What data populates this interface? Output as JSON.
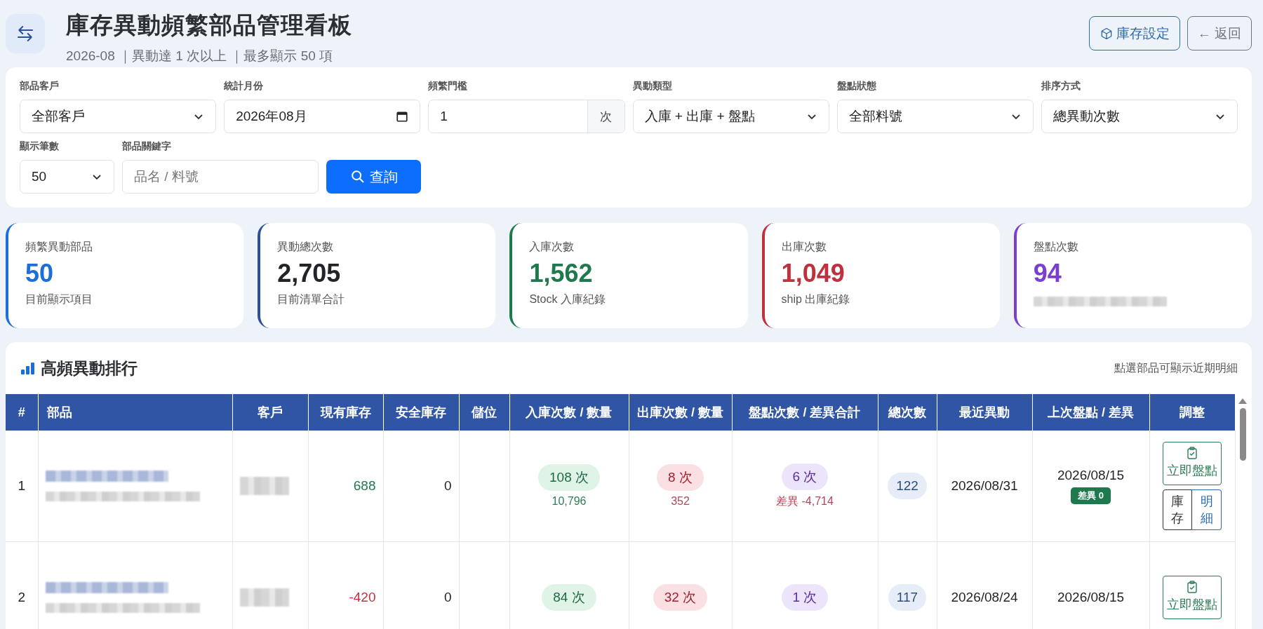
{
  "header": {
    "title": "庫存異動頻繁部品管理看板",
    "subtitle": "2026-08 ｜異動達 1 次以上 ｜最多顯示 50 項",
    "buttons": [
      {
        "kind": "settings",
        "label": "庫存設定"
      },
      {
        "kind": "back",
        "label": "← 返回"
      }
    ]
  },
  "filters": [
    {
      "kind": "select",
      "label": "部品客戶",
      "value": "全部客戶"
    },
    {
      "kind": "date",
      "label": "統計月份",
      "value": "2026年08月"
    },
    {
      "kind": "number",
      "label": "頻繁門檻",
      "value": "1",
      "unit": "次"
    },
    {
      "kind": "select",
      "label": "異動類型",
      "value": "入庫 + 出庫 + 盤點"
    },
    {
      "kind": "select",
      "label": "盤點狀態",
      "value": "全部料號"
    },
    {
      "kind": "select",
      "label": "排序方式",
      "value": "總異動次數"
    },
    {
      "kind": "select-small",
      "label": "顯示筆數",
      "value": "50"
    },
    {
      "kind": "text",
      "label": "部品關鍵字",
      "placeholder": "品名 / 料號"
    }
  ],
  "search_button": "查詢",
  "stats": [
    {
      "label": "頻繁異動部品",
      "value": "50",
      "note": "目前顯示項目",
      "color": "#1c6fd8"
    },
    {
      "label": "異動總次數",
      "value": "2,705",
      "note": "目前清單合計",
      "color": "#2c4f9a"
    },
    {
      "label": "入庫次數",
      "value": "1,562",
      "note": "Stock 入庫紀錄",
      "color": "#1e7a4c"
    },
    {
      "label": "出庫次數",
      "value": "1,049",
      "note": "ship 出庫紀錄",
      "color": "#c0313f"
    },
    {
      "label": "盤點次數",
      "value": "94",
      "color": "#7a3fcf"
    }
  ],
  "ranking": {
    "title": "高頻異動排行",
    "hint": "點選部品可顯示近期明細",
    "columns": [
      "#",
      "部品",
      "客戶",
      "現有庫存",
      "安全庫存",
      "儲位",
      "入庫次數 / 數量",
      "出庫次數 / 數量",
      "盤點次數 / 差異合計",
      "總次數",
      "最近異動",
      "上次盤點 / 差異",
      "調整"
    ],
    "rows": [
      {
        "rank": "1",
        "stock": "688",
        "negative": false,
        "safety": "0",
        "in_count": "108 次",
        "in_qty": "10,796",
        "out_count": "8 次",
        "out_qty": "352",
        "check_count": "6 次",
        "check_diff": "差異 -4,714",
        "total": "122",
        "recent": "2026/08/31",
        "last_check": "2026/08/15",
        "last_diff": "差異 0",
        "actions": [
          {
            "kind": "check",
            "label": "立即盤點"
          },
          {
            "kind": "stock",
            "label": "庫存"
          },
          {
            "kind": "detail",
            "label": "明細"
          }
        ]
      },
      {
        "rank": "2",
        "stock": "-420",
        "negative": true,
        "safety": "0",
        "in_count": "84 次",
        "out_count": "32 次",
        "check_count": "1 次",
        "total": "117",
        "recent": "2026/08/24",
        "last_check": "2026/08/15",
        "actions": [
          {
            "kind": "check",
            "label": "立即盤點"
          }
        ]
      }
    ]
  }
}
